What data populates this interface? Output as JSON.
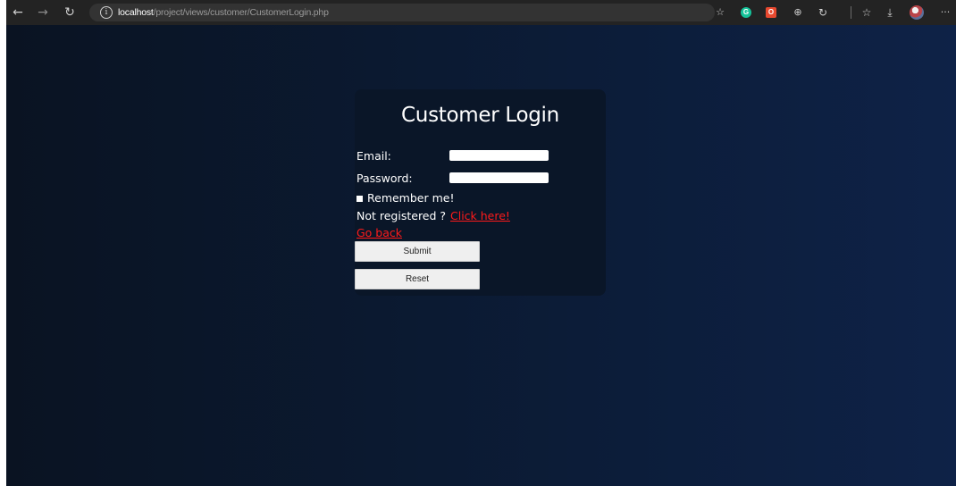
{
  "browser": {
    "url_host": "localhost",
    "url_path": "/project/views/customer/CustomerLogin.php",
    "icons": {
      "back": "back-arrow-icon",
      "forward": "forward-arrow-icon",
      "refresh": "refresh-icon",
      "info": "info-icon",
      "favorites_add": "add-favorite-icon",
      "grammarly": "grammarly-extension-icon",
      "office": "office-extension-icon",
      "extension": "extension-icon",
      "collections": "collections-icon",
      "favorites": "favorites-icon",
      "downloads": "downloads-icon",
      "profile": "profile-avatar",
      "menu": "more-menu-icon"
    }
  },
  "login": {
    "title": "Customer Login",
    "email_label": "Email:",
    "email_value": "",
    "password_label": "Password:",
    "password_value": "",
    "remember_label": "Remember me!",
    "not_registered": "Not registered ?",
    "register_link": "Click here!",
    "go_back": "Go back",
    "submit": "Submit",
    "reset": "Reset"
  },
  "colors": {
    "background_left": "#0a1322",
    "background_right": "#0e2247",
    "card": "#0a1628",
    "link": "#ff1a1a",
    "toolbar": "#232323"
  }
}
